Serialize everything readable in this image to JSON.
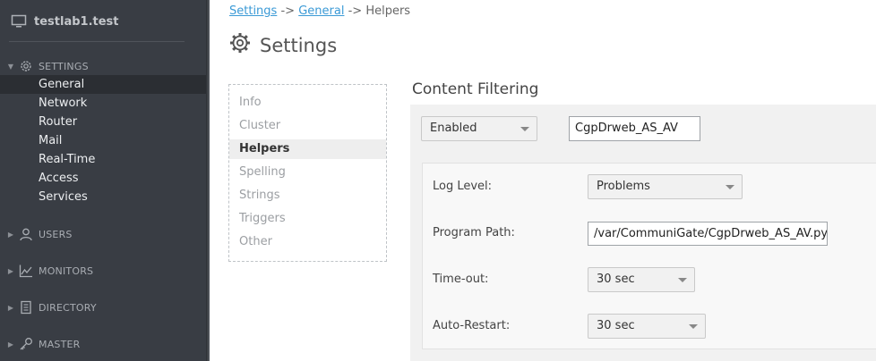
{
  "sidebar": {
    "host": "testlab1.test",
    "sections": {
      "settings": "SETTINGS",
      "users": "USERS",
      "monitors": "MONITORS",
      "directory": "DIRECTORY",
      "master": "MASTER"
    },
    "settings_items": [
      "General",
      "Network",
      "Router",
      "Mail",
      "Real-Time",
      "Access",
      "Services"
    ],
    "active_item": "General"
  },
  "breadcrumb": {
    "settings": "Settings",
    "sep1": "->",
    "general": "General",
    "sep2": "->",
    "current": "Helpers"
  },
  "page": {
    "title": "Settings"
  },
  "subnav": {
    "items": [
      "Info",
      "Cluster",
      "Helpers",
      "Spelling",
      "Strings",
      "Triggers",
      "Other"
    ],
    "active": "Helpers"
  },
  "content_filtering": {
    "title": "Content Filtering",
    "state": "Enabled",
    "helper_name": "CgpDrweb_AS_AV",
    "log_level_label": "Log Level:",
    "log_level": "Problems",
    "program_path_label": "Program Path:",
    "program_path": "/var/CommuniGate/CgpDrweb_AS_AV.py",
    "timeout_label": "Time-out:",
    "timeout": "30 sec",
    "auto_restart_label": "Auto-Restart:",
    "auto_restart": "30 sec"
  },
  "colors": {
    "sidebar_bg": "#393d44",
    "link": "#3b9ad6",
    "active_nav_bg": "#2b2e33"
  }
}
